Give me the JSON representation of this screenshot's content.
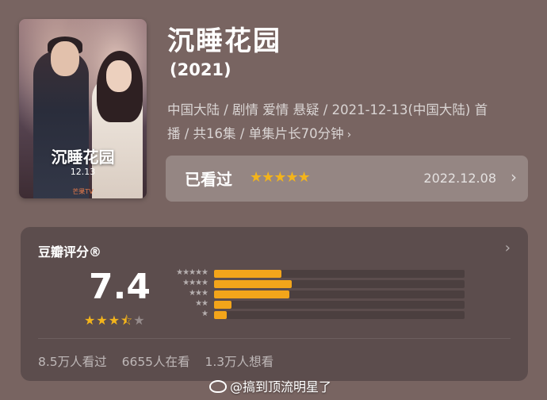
{
  "poster": {
    "title": "沉睡花园",
    "date": "12.13",
    "logo": "芒果TV"
  },
  "movie": {
    "title": "沉睡花园",
    "year": "(2021)",
    "meta_line1": "中国大陆 / 剧情 爱情 悬疑 / 2021-12-13(中国大陆) 首",
    "meta_line2": "播 / 共16集 / 单集片长70分钟",
    "meta_chevron": "›"
  },
  "watched": {
    "label": "已看过",
    "stars": "★★★★★",
    "date": "2022.12.08",
    "chevron": "›"
  },
  "rating": {
    "title": "豆瓣评分®",
    "chevron": "›",
    "score": "7.4",
    "stars_value": 3.5,
    "distribution": [
      {
        "stars": "★★★★★",
        "fraction": 0.27
      },
      {
        "stars": "★★★★",
        "fraction": 0.31
      },
      {
        "stars": "★★★",
        "fraction": 0.3
      },
      {
        "stars": "★★",
        "fraction": 0.07
      },
      {
        "stars": "★",
        "fraction": 0.05
      }
    ],
    "footer": {
      "watched": "8.5万人看过",
      "watching": "6655人在看",
      "want": "1.3万人想看"
    }
  },
  "watermark": {
    "text": "@搞到顶流明星了",
    "icon": "weibo-icon"
  },
  "colors": {
    "background": "#786461",
    "panel": "#5c4d4d",
    "star": "#f3b41b",
    "bar": "#f3a51a"
  }
}
